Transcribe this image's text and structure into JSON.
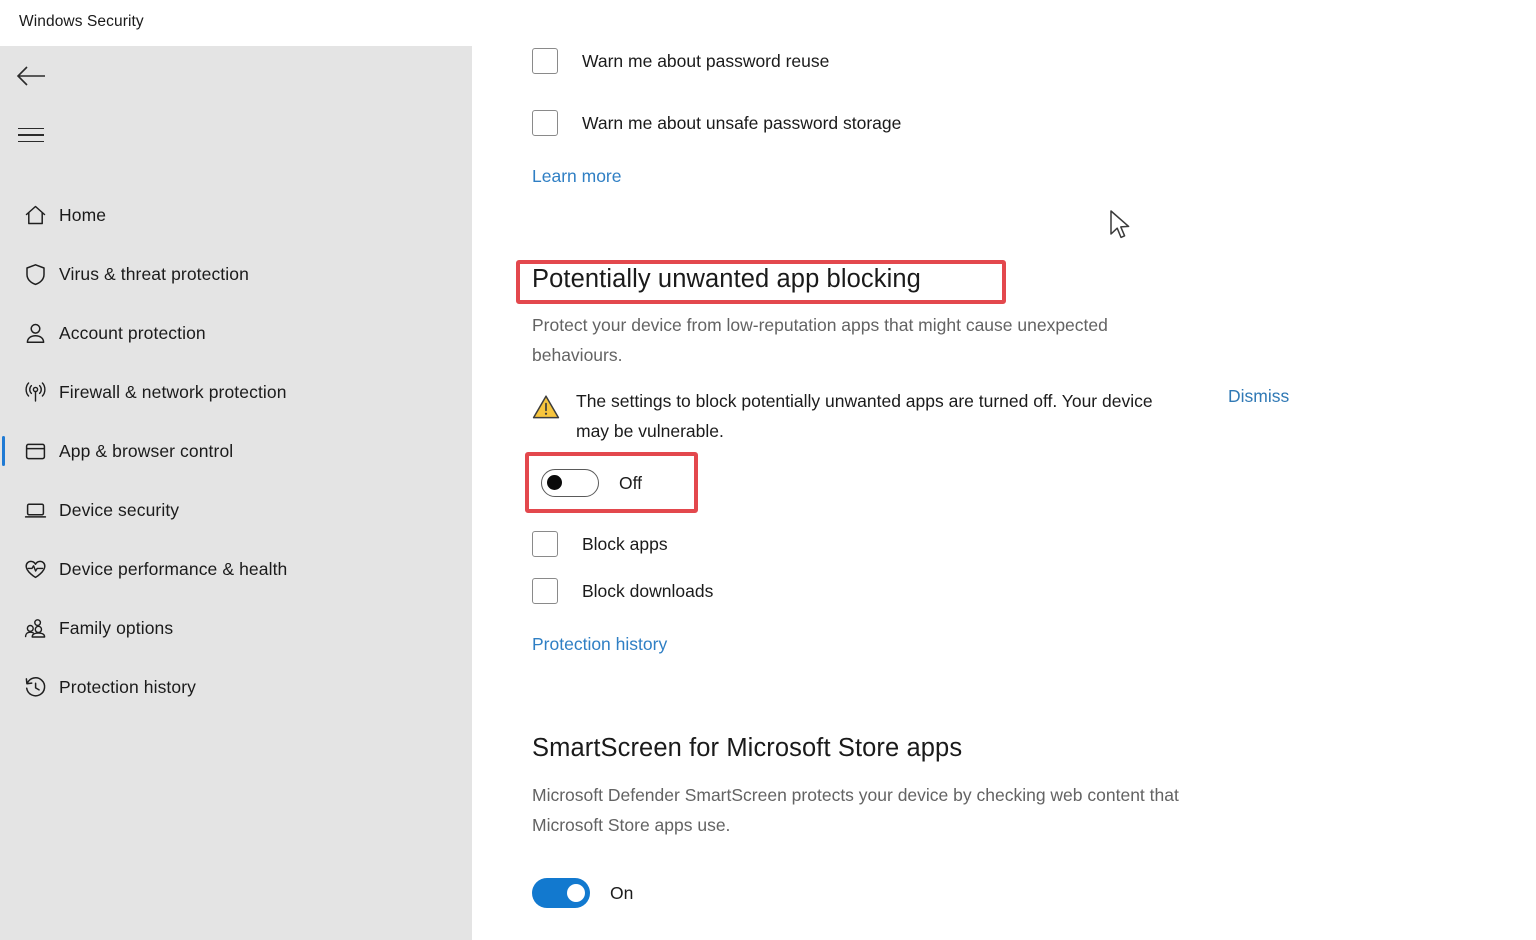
{
  "window": {
    "title": "Windows Security"
  },
  "sidebar": {
    "back_label": "Back",
    "menu_label": "Open navigation",
    "items": [
      {
        "label": "Home",
        "icon": "home-icon",
        "active": false
      },
      {
        "label": "Virus & threat protection",
        "icon": "shield-icon",
        "active": false
      },
      {
        "label": "Account protection",
        "icon": "person-icon",
        "active": false
      },
      {
        "label": "Firewall & network protection",
        "icon": "broadcast-icon",
        "active": false
      },
      {
        "label": "App & browser control",
        "icon": "app-window-icon",
        "active": true
      },
      {
        "label": "Device security",
        "icon": "laptop-icon",
        "active": false
      },
      {
        "label": "Device performance & health",
        "icon": "heart-pulse-icon",
        "active": false
      },
      {
        "label": "Family options",
        "icon": "people-icon",
        "active": false
      },
      {
        "label": "Protection history",
        "icon": "history-clock-icon",
        "active": false
      }
    ]
  },
  "main": {
    "password_section": {
      "checkboxes": [
        {
          "label": "Warn me about password reuse",
          "checked": false
        },
        {
          "label": "Warn me about unsafe password storage",
          "checked": false
        }
      ],
      "learn_more": "Learn more"
    },
    "pua_section": {
      "heading": "Potentially unwanted app blocking",
      "description": "Protect your device from low-reputation apps that might cause unexpected behaviours.",
      "warning": {
        "icon": "warning-triangle-icon",
        "text": "The settings to block potentially unwanted apps are turned off. Your device may be vulnerable.",
        "dismiss_label": "Dismiss"
      },
      "toggle": {
        "state_label": "Off",
        "on": false
      },
      "checkboxes": [
        {
          "label": "Block apps",
          "checked": false
        },
        {
          "label": "Block downloads",
          "checked": false
        }
      ],
      "protection_history_link": "Protection history"
    },
    "smartscreen_section": {
      "heading": "SmartScreen for Microsoft Store apps",
      "description": "Microsoft Defender SmartScreen protects your device by checking web content that Microsoft Store apps use.",
      "toggle": {
        "state_label": "On",
        "on": true
      }
    }
  },
  "annotations": {
    "heading_highlight_color": "#e3484d",
    "toggle_highlight_color": "#e3484d"
  },
  "colors": {
    "accent_blue": "#1279cf",
    "link_blue": "#3079b5",
    "sidebar_bg": "#e4e4e4",
    "warning_amber": "#f2b705"
  }
}
